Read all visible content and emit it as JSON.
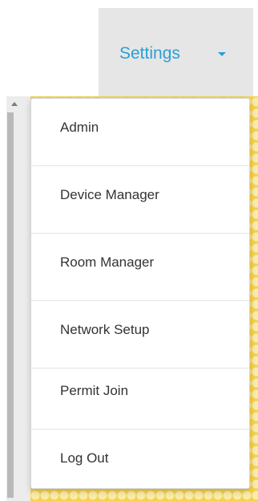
{
  "nav": {
    "settings_label": "Settings"
  },
  "menu": {
    "items": [
      {
        "label": "Admin"
      },
      {
        "label": "Device Manager"
      },
      {
        "label": "Room Manager"
      },
      {
        "label": "Network Setup"
      },
      {
        "label": "Permit Join"
      },
      {
        "label": "Log Out"
      }
    ]
  },
  "colors": {
    "accent": "#2a9fd6",
    "nav_active_bg": "#e6e6e6",
    "background_pattern": "#f5d247"
  }
}
